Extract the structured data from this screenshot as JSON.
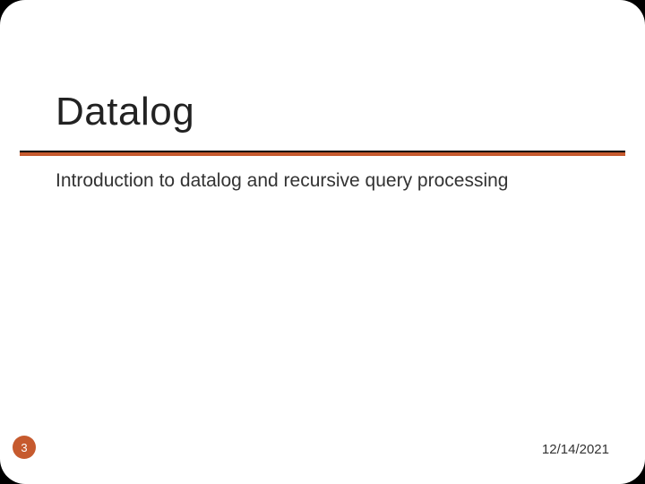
{
  "slide": {
    "title": "Datalog",
    "subtitle": "Introduction to datalog and recursive query processing",
    "page_number": "3",
    "date": "12/14/2021"
  }
}
